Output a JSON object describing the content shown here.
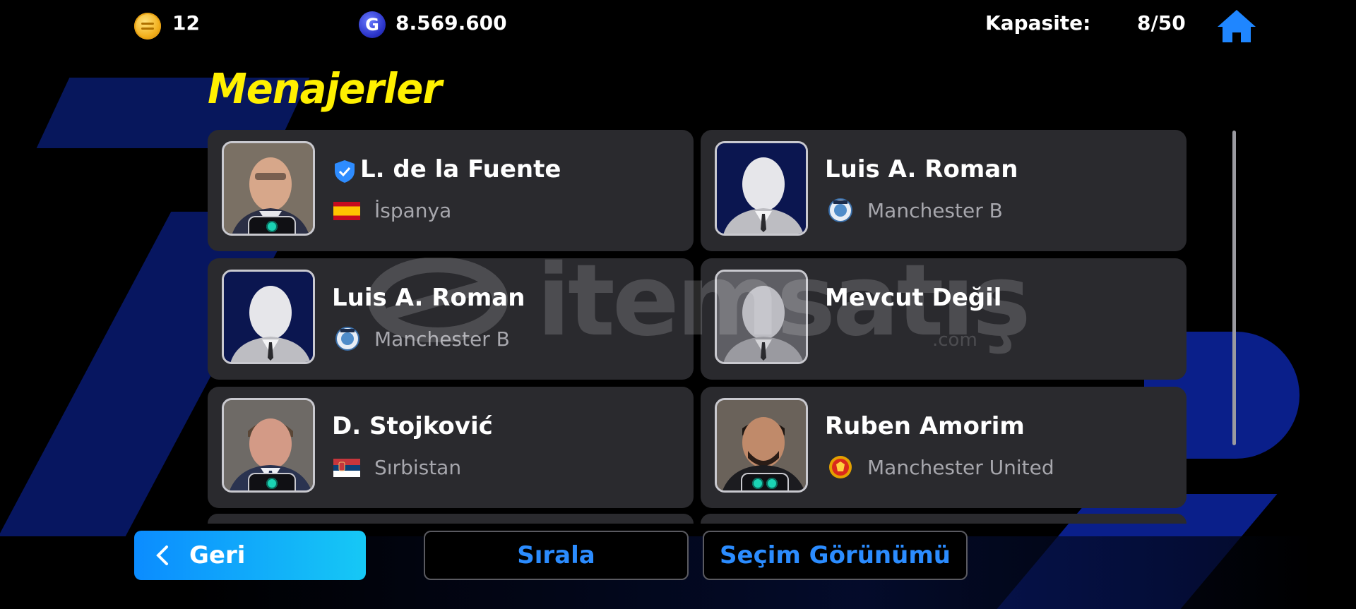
{
  "topbar": {
    "coins": "12",
    "gp": "8.569.600",
    "gp_icon_letter": "G",
    "capacity_label": "Kapasite:",
    "capacity_value": "8/50"
  },
  "title": "Menajerler",
  "managers": [
    {
      "name": "L. de la Fuente",
      "sub": "İspanya",
      "sub_icon": "spain-flag-icon",
      "verified": true,
      "photo": true,
      "badges": 1
    },
    {
      "name": "Luis A. Roman",
      "sub": "Manchester B",
      "sub_icon": "club-crest-icon",
      "verified": false,
      "photo": false,
      "badges": 0
    },
    {
      "name": "Luis A. Roman",
      "sub": "Manchester B",
      "sub_icon": "club-crest-icon",
      "verified": false,
      "photo": false,
      "badges": 0
    },
    {
      "name": "Mevcut Değil",
      "sub": "",
      "sub_icon": "",
      "verified": false,
      "photo": false,
      "badges": 0
    },
    {
      "name": "D. Stojković",
      "sub": "Sırbistan",
      "sub_icon": "serbia-flag-icon",
      "verified": false,
      "photo": true,
      "badges": 1
    },
    {
      "name": "Ruben Amorim",
      "sub": "Manchester United",
      "sub_icon": "manchester-united-crest-icon",
      "verified": false,
      "photo": true,
      "badges": 2
    }
  ],
  "buttons": {
    "back": "Geri",
    "sort": "Sırala",
    "selection_view": "Seçim Görünümü"
  },
  "watermark": {
    "text": "itemsatış",
    "suffix": ".com"
  },
  "colors": {
    "title": "#fff000",
    "accent": "#2b8cff",
    "card": "#2a2a2e"
  }
}
